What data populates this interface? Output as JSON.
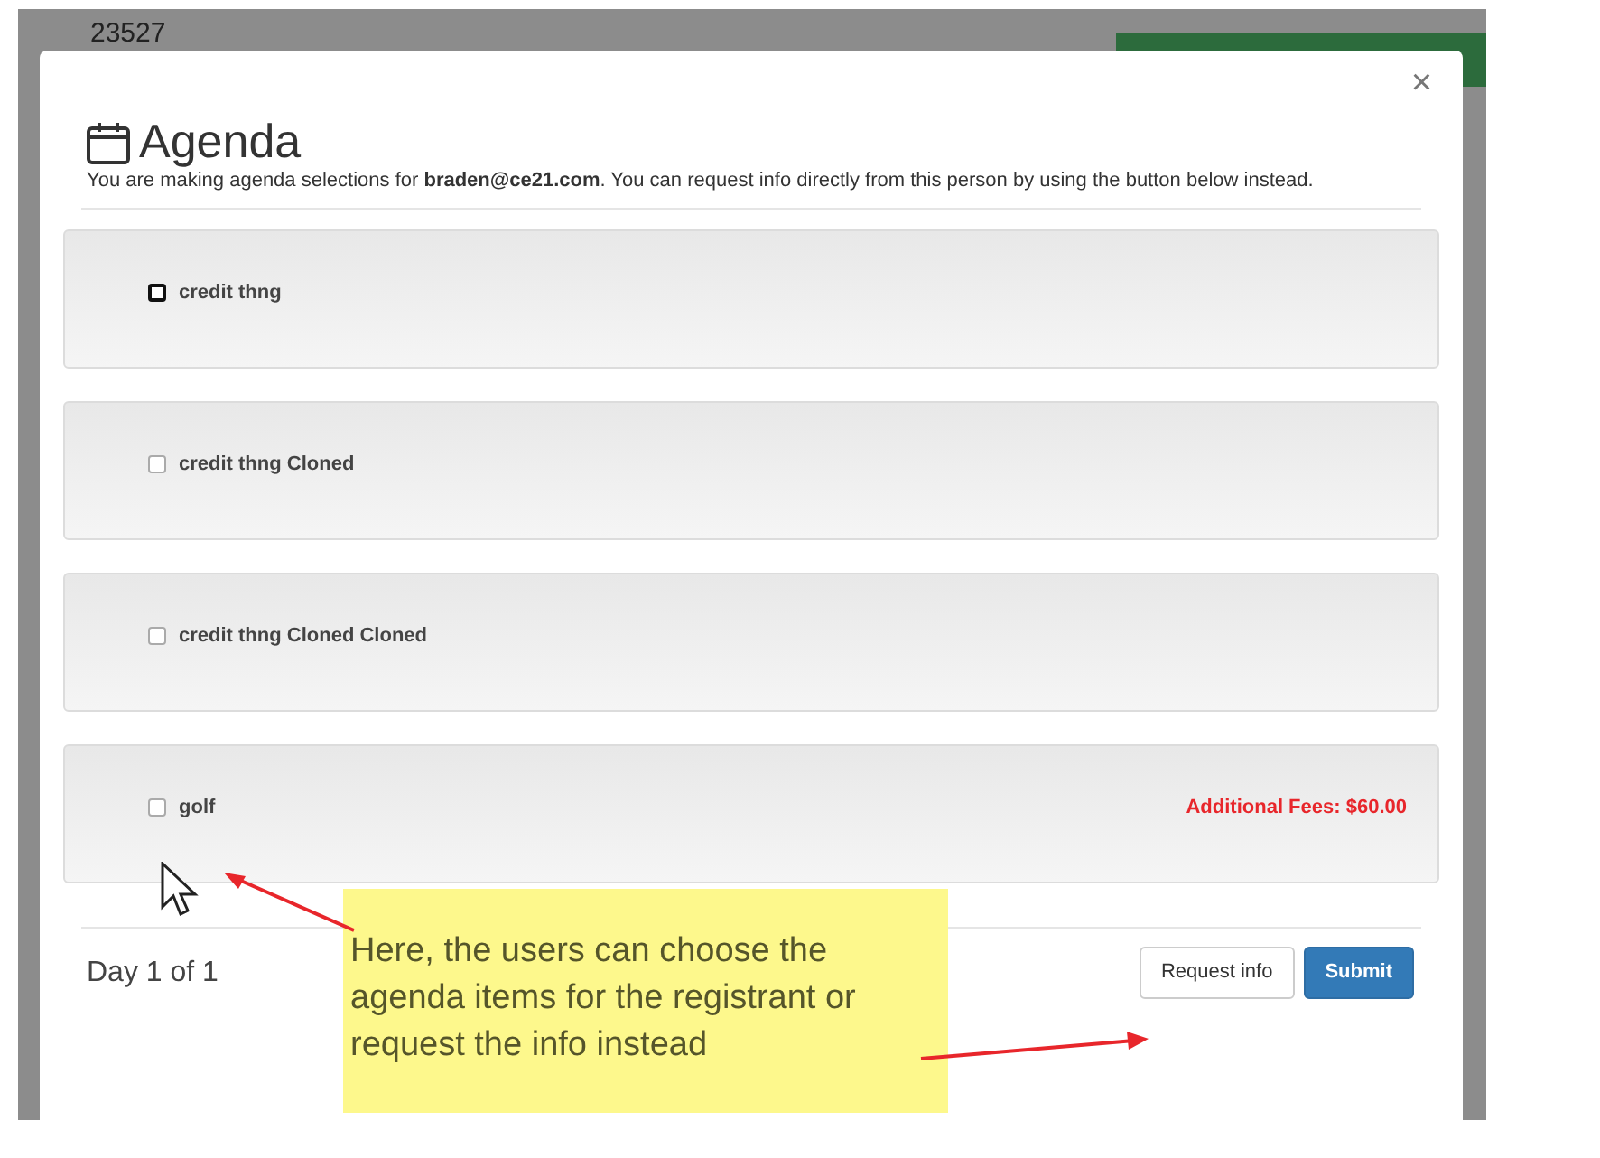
{
  "background_page": {
    "record_number": "23527"
  },
  "modal": {
    "close": "×",
    "title": "Agenda",
    "description": "You are making agenda selections for **braden@ce21.com**. You can request info directly from this person by using the button below instead.",
    "items": [
      {
        "label": "credit thng",
        "checked": false,
        "focused": true
      },
      {
        "label": "credit thng Cloned",
        "checked": false,
        "focused": false
      },
      {
        "label": "credit thng Cloned Cloned",
        "checked": false,
        "focused": false
      },
      {
        "label": "golf",
        "checked": false,
        "focused": false,
        "fee": "Additional Fees: $60.00"
      }
    ],
    "pager": "Day 1 of 1",
    "buttons": [
      {
        "label": "Request info",
        "kind": "default"
      },
      {
        "label": "Submit",
        "kind": "primary"
      }
    ]
  },
  "annotation": {
    "text": "Here, the users can choose the agenda items for the registrant or request the info instead"
  }
}
